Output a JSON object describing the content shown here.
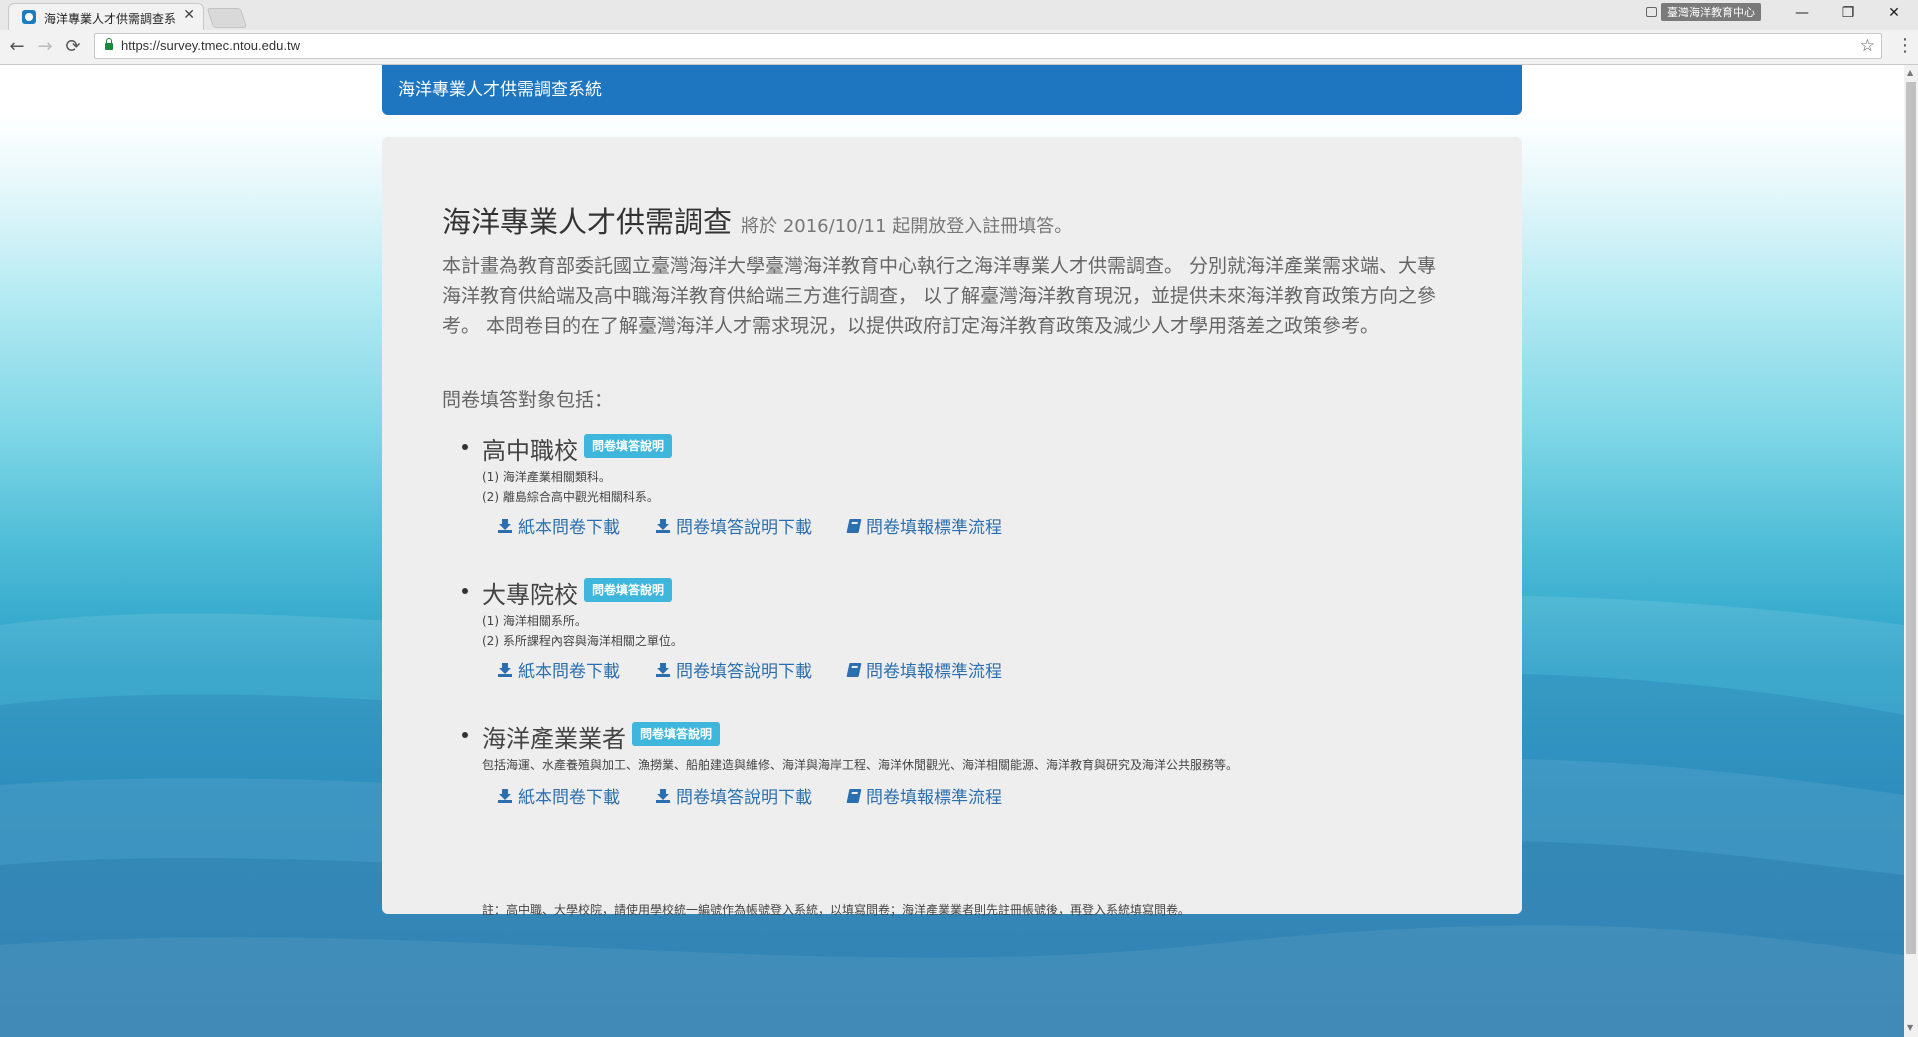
{
  "browser": {
    "tab_title": "海洋專業人才供需調查系",
    "tab_close": "✕",
    "profile_name": "臺灣海洋教育中心",
    "window_controls": {
      "minimize": "—",
      "restore": "❐",
      "close": "✕"
    },
    "nav": {
      "back": "←",
      "forward": "→",
      "reload": "⟳"
    },
    "url": "https://survey.tmec.ntou.edu.tw",
    "bookmark_icon": "☆",
    "menu_icon": "⋮"
  },
  "site": {
    "header_title": "海洋專業人才供需調查系統"
  },
  "main": {
    "heading": "海洋專業人才供需調查",
    "heading_sub": "將於 2016/10/11 起開放登入註冊填答。",
    "intro": "本計畫為教育部委託國立臺灣海洋大學臺灣海洋教育中心執行之海洋專業人才供需調查。 分別就海洋產業需求端、大專海洋教育供給端及高中職海洋教育供給端三方進行調查， 以了解臺灣海洋教育現況，並提供未來海洋教育政策方向之參考。 本問卷目的在了解臺灣海洋人才需求現況，以提供政府訂定海洋教育政策及減少人才學用落差之政策參考。",
    "targets_label": "問卷填答對象包括：",
    "targets": [
      {
        "title": "高中職校",
        "badge": "問卷填答說明",
        "desc": [
          "(1) 海洋產業相關類科。",
          "(2) 離島綜合高中觀光相關科系。"
        ],
        "links": [
          "紙本問卷下載",
          "問卷填答說明下載",
          "問卷填報標準流程"
        ]
      },
      {
        "title": "大專院校",
        "badge": "問卷填答說明",
        "desc": [
          "(1) 海洋相關系所。",
          "(2) 系所課程內容與海洋相關之單位。"
        ],
        "links": [
          "紙本問卷下載",
          "問卷填答說明下載",
          "問卷填報標準流程"
        ]
      },
      {
        "title": "海洋產業業者",
        "badge": "問卷填答說明",
        "desc": [
          "包括海運、水產養殖與加工、漁撈業、船舶建造與維修、海洋與海岸工程、海洋休閒觀光、海洋相關能源、海洋教育與研究及海洋公共服務等。"
        ],
        "links": [
          "紙本問卷下載",
          "問卷填答說明下載",
          "問卷填報標準流程"
        ]
      }
    ],
    "note": "註：高中職、大學校院，請使用學校統一編號作為帳號登入系統，以填寫問卷；海洋產業業者則先註冊帳號後，再登入系統填寫問卷。"
  },
  "colors": {
    "header_bg": "#1f76c0",
    "badge_bg": "#3fb6dc",
    "link": "#2c6fb0",
    "card_bg": "#eeeeee"
  }
}
